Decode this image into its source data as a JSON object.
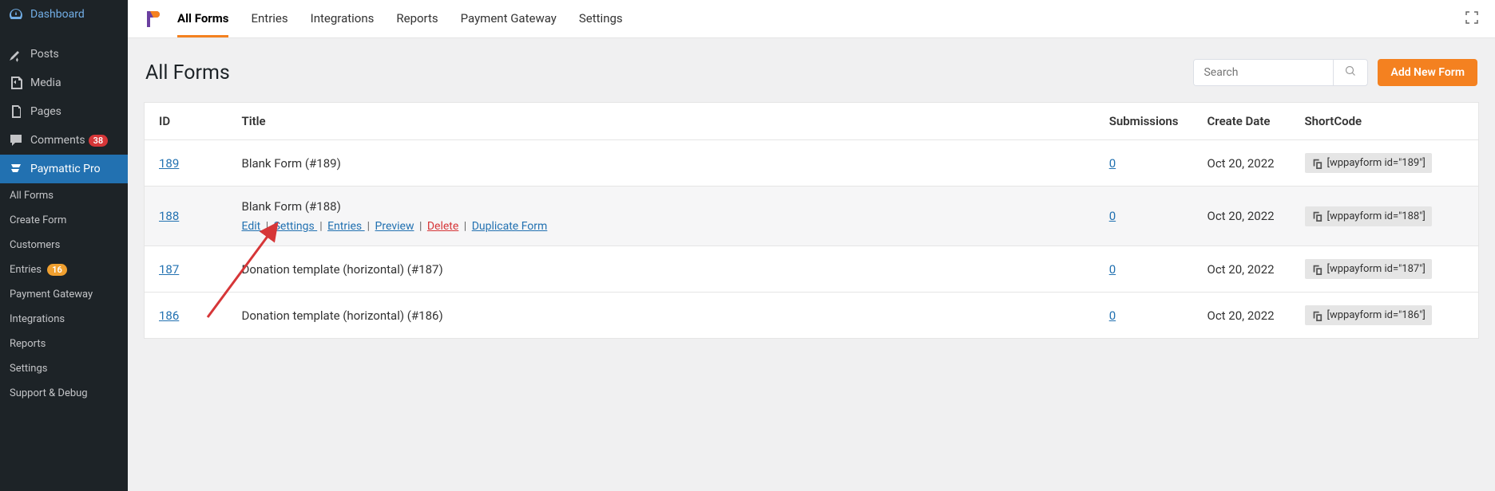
{
  "wp_sidebar": {
    "items": [
      {
        "label": "Dashboard"
      },
      {
        "label": "Posts"
      },
      {
        "label": "Media"
      },
      {
        "label": "Pages"
      },
      {
        "label": "Comments",
        "badge": "38",
        "badge_color": "red"
      },
      {
        "label": "Paymattic Pro"
      }
    ],
    "subitems": [
      {
        "label": "All Forms"
      },
      {
        "label": "Create Form"
      },
      {
        "label": "Customers"
      },
      {
        "label": "Entries",
        "badge": "16",
        "badge_color": "orange"
      },
      {
        "label": "Payment Gateway"
      },
      {
        "label": "Integrations"
      },
      {
        "label": "Reports"
      },
      {
        "label": "Settings"
      },
      {
        "label": "Support & Debug"
      }
    ]
  },
  "topnav": {
    "items": [
      {
        "label": "All Forms",
        "active": true
      },
      {
        "label": "Entries"
      },
      {
        "label": "Integrations"
      },
      {
        "label": "Reports"
      },
      {
        "label": "Payment Gateway"
      },
      {
        "label": "Settings"
      }
    ]
  },
  "page": {
    "title": "All Forms",
    "search_placeholder": "Search",
    "add_button": "Add New Form"
  },
  "table": {
    "headers": {
      "id": "ID",
      "title": "Title",
      "submissions": "Submissions",
      "date": "Create Date",
      "shortcode": "ShortCode"
    },
    "rows": [
      {
        "id": "189",
        "title": "Blank Form (#189)",
        "submissions": "0",
        "date": "Oct 20, 2022",
        "shortcode": "[wppayform id=\"189\"]",
        "show_actions": false
      },
      {
        "id": "188",
        "title": "Blank Form (#188)",
        "submissions": "0",
        "date": "Oct 20, 2022",
        "shortcode": "[wppayform id=\"188\"]",
        "show_actions": true
      },
      {
        "id": "187",
        "title": "Donation template (horizontal) (#187)",
        "submissions": "0",
        "date": "Oct 20, 2022",
        "shortcode": "[wppayform id=\"187\"]",
        "show_actions": false
      },
      {
        "id": "186",
        "title": "Donation template (horizontal) (#186)",
        "submissions": "0",
        "date": "Oct 20, 2022",
        "shortcode": "[wppayform id=\"186\"]",
        "show_actions": false
      }
    ],
    "actions": {
      "edit": "Edit",
      "settings": "Settings",
      "entries": "Entries",
      "preview": "Preview",
      "delete": "Delete",
      "duplicate": "Duplicate Form"
    }
  }
}
